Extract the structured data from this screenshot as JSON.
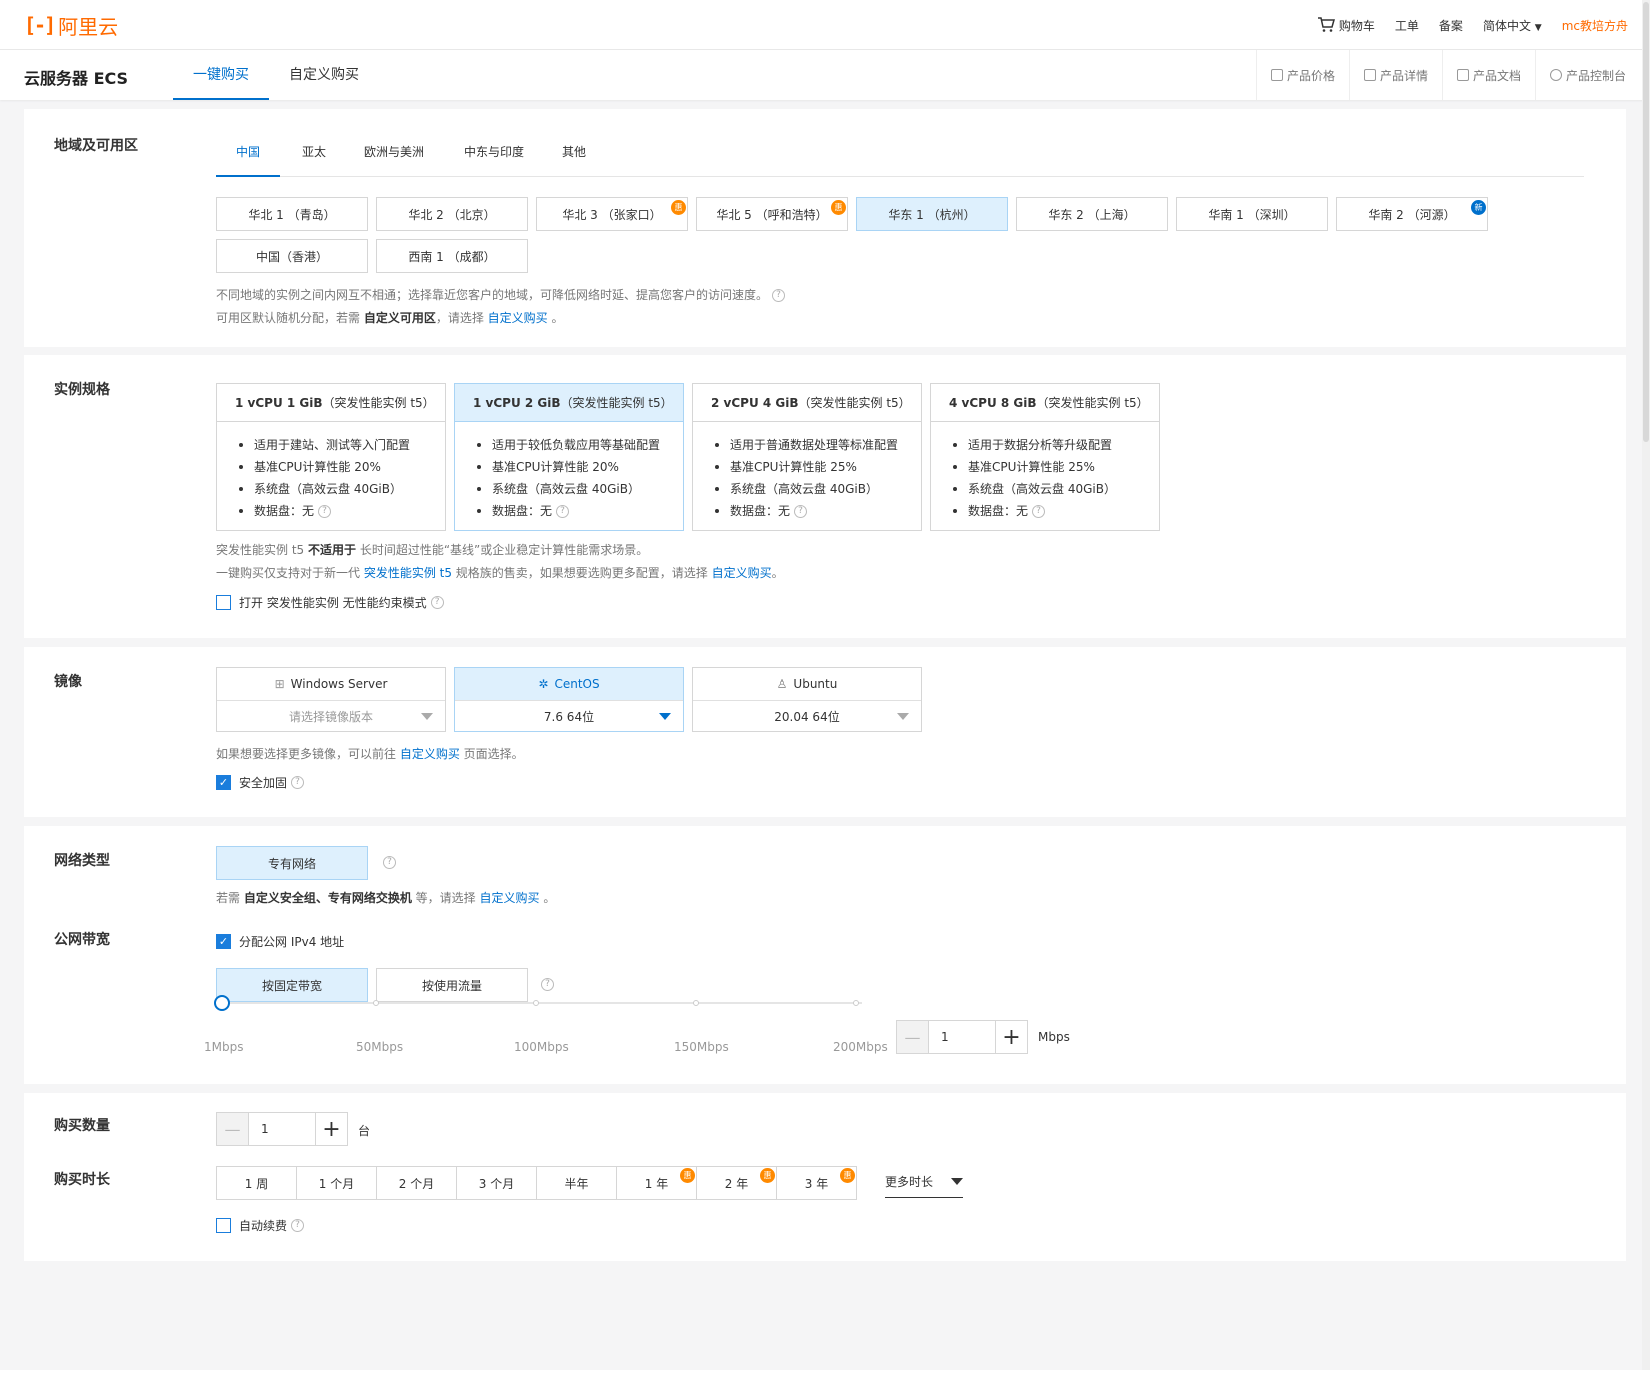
{
  "topbar": {
    "logo_mark": "[-]",
    "logo_text": "阿里云",
    "cart": "购物车",
    "ticket": "工单",
    "icp": "备案",
    "lang": "简体中文",
    "user": "mc教培方舟"
  },
  "subbar": {
    "product": "云服务器 ECS",
    "tabs": [
      "一键购买",
      "自定义购买"
    ],
    "links": [
      "产品价格",
      "产品详情",
      "产品文档",
      "产品控制台"
    ]
  },
  "region": {
    "label": "地域及可用区",
    "tabs": [
      "中国",
      "亚太",
      "欧洲与美洲",
      "中东与印度",
      "其他"
    ],
    "options": [
      "华北 1 （青岛）",
      "华北 2 （北京）",
      "华北 3 （张家口）",
      "华北 5 （呼和浩特）",
      "华东 1 （杭州）",
      "华东 2 （上海）",
      "华南 1 （深圳）",
      "华南 2 （河源）",
      "中国（香港）",
      "西南 1 （成都）"
    ],
    "badge_discount": "惠",
    "badge_new": "新",
    "note1": "不同地域的实例之间内网互不相通；选择靠近您客户的地域，可降低网络时延、提高您客户的访问速度。",
    "note2_pre": "可用区默认随机分配，若需 ",
    "note2_bold": "自定义可用区",
    "note2_mid": "，请选择 ",
    "note2_link": "自定义购买",
    "note2_end": " 。"
  },
  "spec": {
    "label": "实例规格",
    "cards": [
      {
        "title": "1 vCPU 1 GiB",
        "family": "（突发性能实例 t5）",
        "items": [
          "适用于建站、测试等入门配置",
          "基准CPU计算性能 20%",
          "系统盘（高效云盘 40GiB）",
          "数据盘：无"
        ]
      },
      {
        "title": "1 vCPU 2 GiB",
        "family": "（突发性能实例 t5）",
        "items": [
          "适用于较低负载应用等基础配置",
          "基准CPU计算性能 20%",
          "系统盘（高效云盘 40GiB）",
          "数据盘：无"
        ]
      },
      {
        "title": "2 vCPU 4 GiB",
        "family": "（突发性能实例 t5）",
        "items": [
          "适用于普通数据处理等标准配置",
          "基准CPU计算性能 25%",
          "系统盘（高效云盘 40GiB）",
          "数据盘：无"
        ]
      },
      {
        "title": "4 vCPU 8 GiB",
        "family": "（突发性能实例 t5）",
        "items": [
          "适用于数据分析等升级配置",
          "基准CPU计算性能 25%",
          "系统盘（高效云盘 40GiB）",
          "数据盘：无"
        ]
      }
    ],
    "note1_pre": "突发性能实例 t5 ",
    "note1_bold": "不适用于",
    "note1_end": " 长时间超过性能“基线”或企业稳定计算性能需求场景。",
    "note2_pre": "一键购买仅支持对于新一代 ",
    "note2_link1": "突发性能实例 t5",
    "note2_mid": " 规格族的售卖，如果想要选购更多配置，请选择 ",
    "note2_link2": "自定义购买",
    "note2_end": "。",
    "checkbox": "打开 突发性能实例 无性能约束模式"
  },
  "image": {
    "label": "镜像",
    "cards": [
      {
        "name": "Windows Server",
        "value": "请选择镜像版本"
      },
      {
        "name": "CentOS",
        "value": "7.6 64位"
      },
      {
        "name": "Ubuntu",
        "value": "20.04 64位"
      }
    ],
    "note_pre": "如果想要选择更多镜像，可以前往 ",
    "note_link": "自定义购买",
    "note_end": " 页面选择。",
    "checkbox": "安全加固"
  },
  "network": {
    "label": "网络类型",
    "option": "专有网络",
    "note_pre": "若需 ",
    "note_bold": "自定义安全组、专有网络交换机",
    "note_mid": " 等，请选择 ",
    "note_link": "自定义购买",
    "note_end": " 。"
  },
  "bandwidth": {
    "label": "公网带宽",
    "checkbox": "分配公网 IPv4 地址",
    "options": [
      "按固定带宽",
      "按使用流量"
    ],
    "ticks": [
      "1Mbps",
      "50Mbps",
      "100Mbps",
      "150Mbps",
      "200Mbps"
    ],
    "value": "1",
    "unit": "Mbps",
    "minus": "—",
    "plus": "+"
  },
  "purchase": {
    "qty_label": "购买数量",
    "qty_value": "1",
    "qty_unit": "台",
    "duration_label": "购买时长",
    "durations": [
      "1 周",
      "1 个月",
      "2 个月",
      "3 个月",
      "半年",
      "1 年",
      "2 年",
      "3 年"
    ],
    "more": "更多时长",
    "auto_renew": "自动续费"
  },
  "icons": {
    "help": "?",
    "check": "✓",
    "windows": "⊞",
    "centos": "✲",
    "ubuntu": "♙",
    "cart": "🛒"
  }
}
